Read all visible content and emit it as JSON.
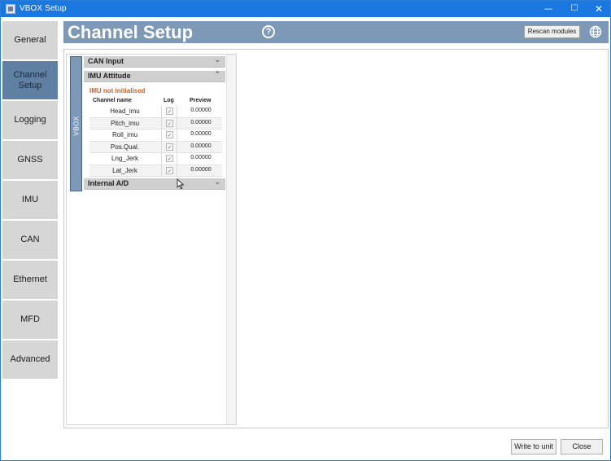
{
  "window": {
    "title": "VBOX Setup",
    "min_glyph": "—",
    "max_glyph": "☐",
    "close_glyph": "✕",
    "accent": "#1a78e0"
  },
  "sidebar": {
    "items": [
      {
        "label": "General",
        "active": false
      },
      {
        "label": "Channel\nSetup",
        "active": true
      },
      {
        "label": "Logging",
        "active": false
      },
      {
        "label": "GNSS",
        "active": false
      },
      {
        "label": "IMU",
        "active": false
      },
      {
        "label": "CAN",
        "active": false
      },
      {
        "label": "Ethernet",
        "active": false
      },
      {
        "label": "MFD",
        "active": false
      },
      {
        "label": "Advanced",
        "active": false
      }
    ]
  },
  "header": {
    "title": "Channel Setup",
    "help_glyph": "?",
    "rescan_label": "Rescan modules",
    "globe_icon": "globe-icon"
  },
  "tree": {
    "vbox_label": "VBOX",
    "sections": [
      {
        "label": "CAN Input",
        "chevron": "⌄"
      },
      {
        "label": "IMU Attitude",
        "chevron": "⌃"
      },
      {
        "label": "Internal A/D",
        "chevron": "⌄"
      }
    ],
    "status": "IMU not initialised",
    "columns": {
      "name": "Channel name",
      "log": "Log",
      "preview": "Preview"
    },
    "rows": [
      {
        "name": "Head_imu",
        "log": "✓",
        "preview": "0.00000"
      },
      {
        "name": "Pitch_imu",
        "log": "✓",
        "preview": "0.00000"
      },
      {
        "name": "Roll_imu",
        "log": "✓",
        "preview": "0.00000"
      },
      {
        "name": "Pos.Qual.",
        "log": "✓",
        "preview": "0.00000"
      },
      {
        "name": "Lng_Jerk",
        "log": "✓",
        "preview": "0.00000"
      },
      {
        "name": "Lat_Jerk",
        "log": "✓",
        "preview": "0.00000"
      }
    ]
  },
  "footer": {
    "write_label": "Write to unit",
    "close_label": "Close"
  },
  "colors": {
    "header_bg": "#7e98b7",
    "active_nav": "#5f7fa3",
    "nav_bg": "#d6d6d6",
    "status_text": "#c0632b"
  }
}
